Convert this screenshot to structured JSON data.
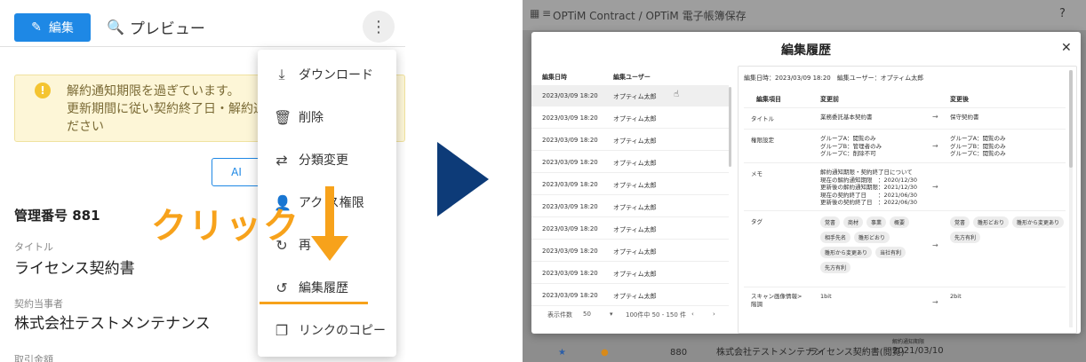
{
  "left": {
    "edit_label": "編集",
    "preview_label": "プレビュー",
    "alert_line1": "解約通知期限を過ぎています。",
    "alert_line2": "更新期間に従い契約終了日・解約通",
    "alert_line3": "ださい",
    "ai_label": "AI",
    "management_number": "管理番号 881",
    "title_label": "タイトル",
    "title_value": "ライセンス契約書",
    "party_label": "契約当事者",
    "party_value": "株式会社テストメンテナンス",
    "amount_label": "取引金額",
    "click_annotation": "クリック",
    "menu": [
      {
        "icon": "download-icon",
        "label": "ダウンロード"
      },
      {
        "icon": "trash-icon",
        "label": "削除"
      },
      {
        "icon": "swap-icon",
        "label": "分類変更"
      },
      {
        "icon": "person-add-icon",
        "label": "アク    ス権限"
      },
      {
        "icon": "refresh-icon",
        "label": "再     "
      },
      {
        "icon": "history-icon",
        "label": "編集履歴"
      },
      {
        "icon": "copy-icon",
        "label": "リンクのコピー"
      }
    ]
  },
  "right": {
    "breadcrumb": "OPTiM Contract / OPTiM 電子帳簿保存",
    "modal_title": "編集履歴",
    "list_headers": [
      "編集日時",
      "編集ユーザー"
    ],
    "list_rows": [
      {
        "date": "2023/03/09 18:20",
        "user": "オプティム太郎"
      },
      {
        "date": "2023/03/09 18:20",
        "user": "オプティム太郎"
      },
      {
        "date": "2023/03/09 18:20",
        "user": "オプティム太郎"
      },
      {
        "date": "2023/03/09 18:20",
        "user": "オプティム太郎"
      },
      {
        "date": "2023/03/09 18:20",
        "user": "オプティム太郎"
      },
      {
        "date": "2023/03/09 18:20",
        "user": "オプティム太郎"
      },
      {
        "date": "2023/03/09 18:20",
        "user": "オプティム太郎"
      },
      {
        "date": "2023/03/09 18:20",
        "user": "オプティム太郎"
      },
      {
        "date": "2023/03/09 18:20",
        "user": "オプティム太郎"
      },
      {
        "date": "2023/03/09 18:20",
        "user": "オプティム太郎"
      }
    ],
    "footer_per_page_label": "表示件数",
    "footer_per_page": "50",
    "footer_range": "100件中 50 - 150 件",
    "detail_header": "編集日時：2023/03/09 18:20　編集ユーザー：オプティム太郎",
    "detail_columns": [
      "編集項目",
      "変更前",
      "変更後"
    ],
    "detail_rows": {
      "title": {
        "field": "タイトル",
        "before": "業務委託基本契約書",
        "after": "保守契約書"
      },
      "perm": {
        "field": "権限設定",
        "before": "グループA：閲覧のみ\nグループB：管理者のみ\nグループC：削除不可",
        "after": "グループA：閲覧のみ\nグループB：閲覧のみ\nグループC：閲覧のみ"
      },
      "memo": {
        "field": "メモ",
        "before": "解約通知期限・契約終了日について\n現在の解約通知期限　：2020/12/30\n更新後の解約通知期限：2021/12/30\n現在の契約終了日　　：2021/06/30\n更新後の契約終了日　：2022/06/30",
        "after": ""
      },
      "tag": {
        "field": "タグ",
        "before_chips": [
          "覚書",
          "商材",
          "事業",
          "概要",
          "相手先名",
          "雛形どおり",
          "雛形から変更あり",
          "当社有利",
          "先方有利"
        ],
        "after_chips": [
          "覚書",
          "雛形どおり",
          "雛形から変更あり",
          "先方有利"
        ]
      },
      "scan": {
        "field": "スキャン画像情報>\n階調",
        "before": "1bit",
        "after": "2bit"
      }
    },
    "bg_number": "880",
    "bg_company": "株式会社テストメンテナン",
    "bg_contract": "ライセンス契約書(閲覧)",
    "bg_date_label": "解約通知期限",
    "bg_date": "2021/03/10"
  }
}
